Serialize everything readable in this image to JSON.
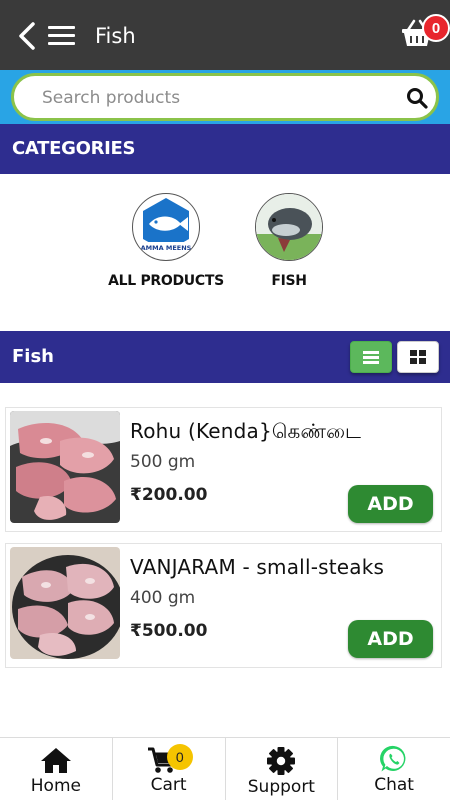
{
  "header": {
    "title": "Fish",
    "cart_count": "0"
  },
  "search": {
    "placeholder": "Search products"
  },
  "categories": {
    "heading": "CATEGORIES",
    "items": [
      {
        "label": "ALL PRODUCTS",
        "icon": "fish-logo-icon",
        "logo_text": "AMMA MEENS"
      },
      {
        "label": "FISH",
        "icon": "fish-photo-icon"
      }
    ]
  },
  "product_section": {
    "heading": "Fish",
    "view_modes": [
      "list-view",
      "grid-view"
    ],
    "selected_view": "list-view"
  },
  "products": [
    {
      "name": "Rohu (Kenda}கெண்டை",
      "quantity": "500 gm",
      "price": "₹200.00",
      "add_label": "ADD"
    },
    {
      "name": "VANJARAM - small-steaks",
      "quantity": "400 gm",
      "price": "₹500.00",
      "add_label": "ADD"
    }
  ],
  "bottom_nav": {
    "items": [
      {
        "label": "Home",
        "icon": "home-icon"
      },
      {
        "label": "Cart",
        "icon": "cart-icon",
        "badge": "0"
      },
      {
        "label": "Support",
        "icon": "gear-icon"
      },
      {
        "label": "Chat",
        "icon": "whatsapp-icon"
      }
    ]
  },
  "colors": {
    "header_bg": "#3a3a3a",
    "search_band": "#29a4e5",
    "search_border": "#8bc34a",
    "section_bar": "#2e2d8f",
    "add_button": "#2e8a32",
    "cart_badge": "#e8262d",
    "nav_badge": "#f5c400",
    "chat_icon": "#25d366"
  }
}
